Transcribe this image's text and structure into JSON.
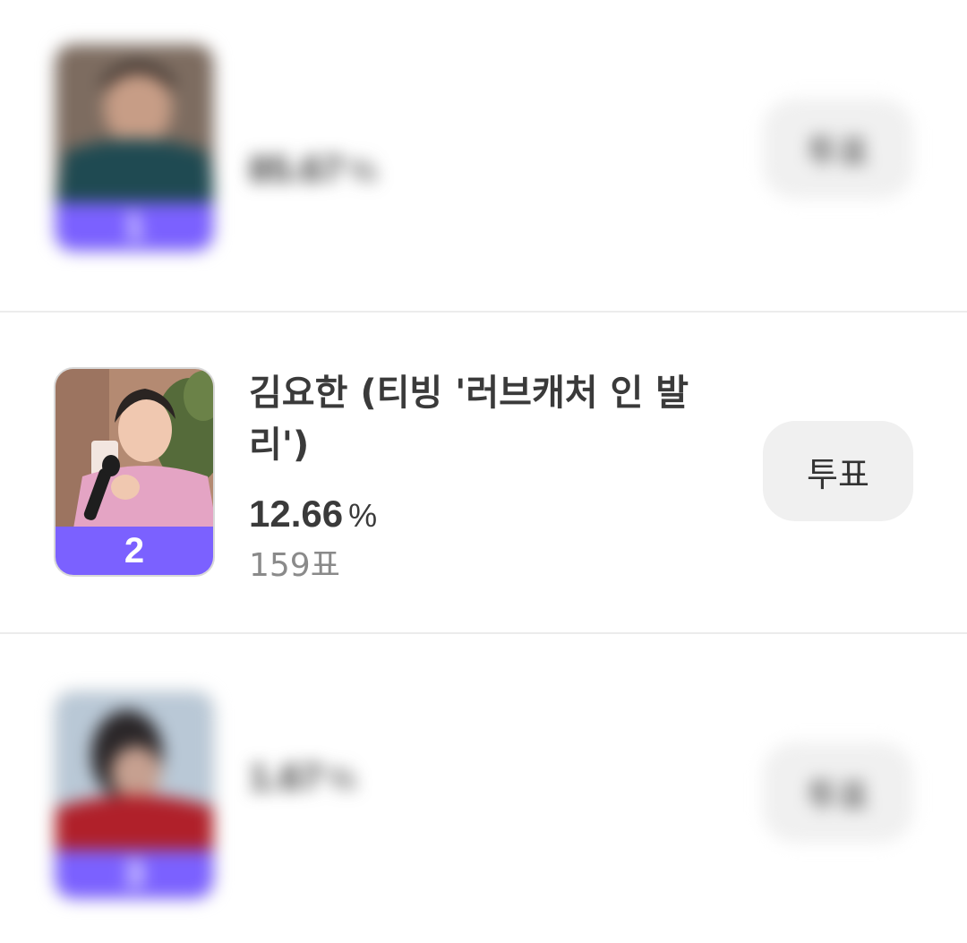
{
  "candidates": [
    {
      "rank": "1",
      "name": "",
      "percent": "85.67",
      "percent_unit": "%",
      "votes": "",
      "vote_button": "투표",
      "blurred": true,
      "photo_colors": {
        "top": "#6a5a4e",
        "shirt": "#1f4a52"
      }
    },
    {
      "rank": "2",
      "name": "김요한 (티빙 '러브캐처 인 발리')",
      "percent": "12.66",
      "percent_unit": "%",
      "votes": "159표",
      "vote_button": "투표",
      "blurred": false,
      "photo_colors": {
        "background": "#b48a72",
        "plant": "#556b3a",
        "sweater": "#e4a4c4",
        "skin": "#f0c8b0",
        "hair": "#2a2422"
      }
    },
    {
      "rank": "3",
      "name": "",
      "percent": "1.67",
      "percent_unit": "%",
      "votes": "",
      "vote_button": "투표",
      "blurred": true,
      "photo_colors": {
        "top": "#b9c8d6",
        "shirt": "#b0202a"
      }
    }
  ],
  "colors": {
    "rank_band": "#7b61ff",
    "vote_button_bg": "#f0f0f0",
    "divider": "#ececec"
  }
}
